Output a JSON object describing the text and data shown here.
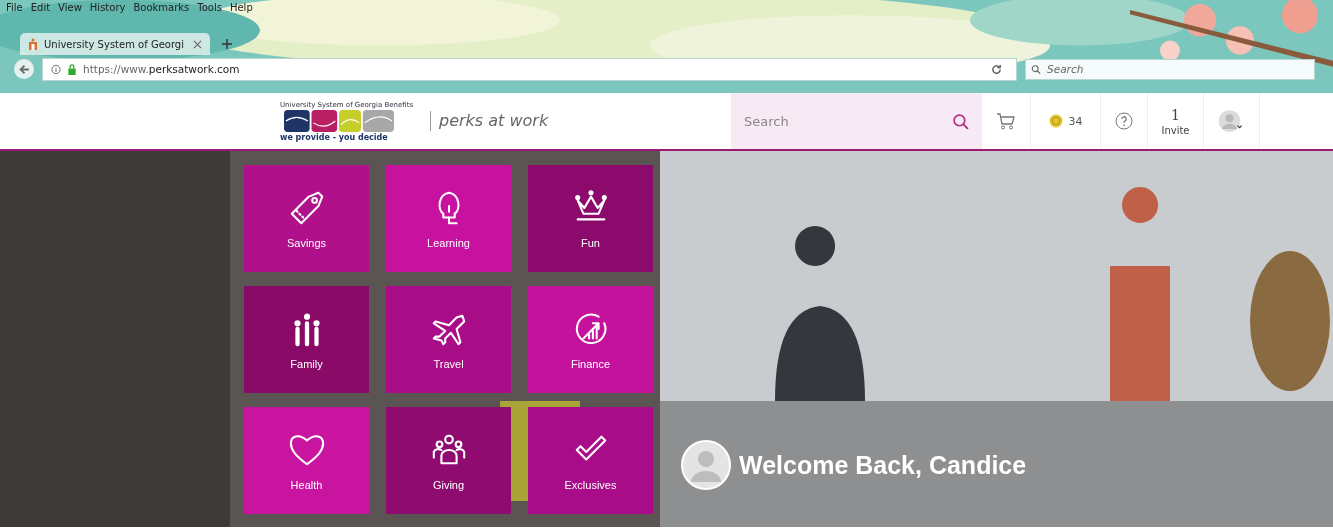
{
  "browser": {
    "menu": [
      "File",
      "Edit",
      "View",
      "History",
      "Bookmarks",
      "Tools",
      "Help"
    ],
    "tab": {
      "title": "University System of Georgi",
      "selected": true
    },
    "url": "https://www.**perksatwork.com**",
    "search": {
      "placeholder": "Search"
    }
  },
  "header": {
    "logo_caption": "University System of Georgia Benefits",
    "logo_tagline": "we provide - you decide",
    "brand": "perks at work",
    "search": {
      "placeholder": "Search"
    },
    "coins": "34",
    "invites": "1",
    "invite_label": "Invite"
  },
  "tiles": [
    {
      "label": "Savings",
      "color": "#b0108a"
    },
    {
      "label": "Learning",
      "color": "#c8119f"
    },
    {
      "label": "Fun",
      "color": "#8c0a6c"
    },
    {
      "label": "Family",
      "color": "#8a0a68"
    },
    {
      "label": "Travel",
      "color": "#a80c86"
    },
    {
      "label": "Finance",
      "color": "#c4129c"
    },
    {
      "label": "Health",
      "color": "#c8149f"
    },
    {
      "label": "Giving",
      "color": "#900b70"
    },
    {
      "label": "Exclusives",
      "color": "#a80c88"
    }
  ],
  "welcome": "Welcome Back, Candice"
}
